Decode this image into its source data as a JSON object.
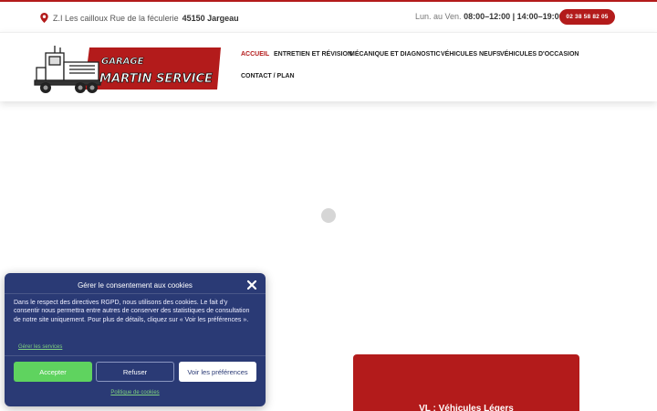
{
  "topbar": {
    "address": "Z.I Les cailloux Rue de la féculerie",
    "city": "45150 Jargeau",
    "hours_prefix": "Lun. au Ven.",
    "hours_value": "08:00–12:00 | 14:00–19:00",
    "phone": "02 38 58 82 05"
  },
  "logo": {
    "line1": "GARAGE",
    "line2": "MARTIN SERVICE"
  },
  "nav": {
    "items": [
      {
        "label": "Accueil"
      },
      {
        "label": "Entretien et révision"
      },
      {
        "label": "Mécanique et diagnostic"
      },
      {
        "label": "Véhicules neufs"
      },
      {
        "label": "Véhicules d'occasion"
      },
      {
        "label": "Contact / Plan"
      }
    ]
  },
  "card": {
    "title": "VL : Véhicules Légers"
  },
  "cookie": {
    "title": "Gérer le consentement aux cookies",
    "text": "Dans le respect des directives RGPD, nous utilisons des cookies. Le fait d'y consentir nous permettra entre autres de conserver des statistiques de consultation de notre site uniquement. Pour plus de détails, cliquez sur « Voir les préférences ».",
    "manage_link": "Gérer les services",
    "accept": "Accepter",
    "refuse": "Refuser",
    "prefs": "Voir les préférences",
    "policy_link": "Politique de cookies"
  },
  "colors": {
    "brand_red": "#b31b1b",
    "modal_blue": "#2a3a75",
    "accept_green": "#5fd35f"
  }
}
